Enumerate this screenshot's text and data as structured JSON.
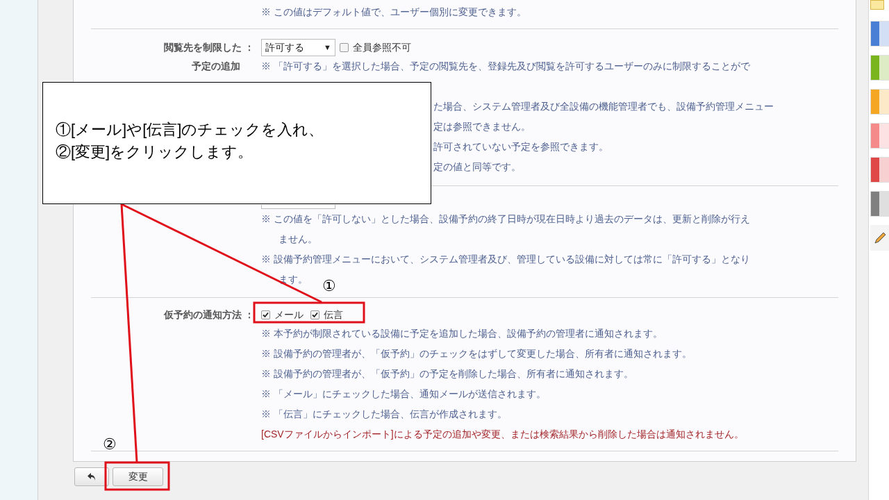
{
  "top_row": {
    "note": "※ この値はデフォルト値で、ユーザー個別に変更できます。"
  },
  "settings": [
    {
      "label_lines": [
        "閲覧先を制限した ：",
        "予定の追加"
      ],
      "control": {
        "kind": "select_checkbox",
        "value": "許可する",
        "arrow": "▼",
        "checkbox": {
          "label": "全員参照不可",
          "checked": false
        }
      },
      "notes": [
        {
          "kind": "note",
          "lines": [
            "※ 「許可する」を選択した場合、予定の閲覧先を、登録先及び閲覧を許可するユーザーのみに制限することがで"
          ]
        },
        {
          "kind": "fragment",
          "lines": [
            "た場合、システム管理者及び全設備の機能管理者でも、設備予約管理メニュー"
          ]
        },
        {
          "kind": "fragment",
          "lines": [
            "定は参照できません。"
          ]
        },
        {
          "kind": "fragment",
          "lines": [
            "許可されていない予定を参照できます。"
          ]
        },
        {
          "kind": "fragment",
          "lines": [
            "定の値と同等です。"
          ]
        }
      ]
    },
    {
      "control": {
        "kind": "select_hidden"
      },
      "notes": [
        {
          "kind": "note",
          "lines": [
            "※ この値を「許可しない」とした場合、設備予約の終了日時が現在日時より過去のデータは、更新と削除が行え",
            "ません。"
          ]
        },
        {
          "kind": "note",
          "lines": [
            "※ 設備予約管理メニューにおいて、システム管理者及び、管理している設備に対しては常に「許可する」となり",
            "ます。"
          ]
        }
      ]
    },
    {
      "label_lines": [
        "仮予約の通知方法 ："
      ],
      "control": {
        "kind": "checkboxes",
        "items": [
          {
            "label": "メール",
            "checked": true
          },
          {
            "label": "伝言",
            "checked": true
          }
        ]
      },
      "notes": [
        {
          "kind": "note",
          "lines": [
            "※ 本予約が制限されている設備に予定を追加した場合、設備予約の管理者に通知されます。"
          ]
        },
        {
          "kind": "note",
          "lines": [
            "※ 設備予約の管理者が、「仮予約」のチェックをはずして変更した場合、所有者に通知されます。"
          ]
        },
        {
          "kind": "note",
          "lines": [
            "※ 設備予約の管理者が、「仮予約」の予定を削除した場合、所有者に通知されます。"
          ]
        },
        {
          "kind": "note",
          "lines": [
            "※ 「メール」にチェックした場合、通知メールが送信されます。"
          ]
        },
        {
          "kind": "note",
          "lines": [
            "※ 「伝言」にチェックした場合、伝言が作成されます。"
          ]
        },
        {
          "kind": "warning",
          "lines": [
            "[CSVファイルからインポート]による予定の追加や変更、または検索結果から削除した場合は通知されません。"
          ]
        }
      ]
    }
  ],
  "buttons": [
    {
      "kind": "back"
    },
    {
      "kind": "text",
      "label": "変更"
    }
  ],
  "side_tabs": [
    {
      "color": "#4a7fd6"
    },
    {
      "color": "#7ab51d"
    },
    {
      "color": "#f5a623"
    },
    {
      "color": "#f48a8a"
    },
    {
      "color": "#e04848"
    },
    {
      "color": "#808080"
    }
  ],
  "callout": {
    "lines": [
      "①[メール]や[伝言]のチェックを入れ、",
      "②[変更]をクリックします。"
    ]
  },
  "markers": [
    "①",
    "②"
  ]
}
